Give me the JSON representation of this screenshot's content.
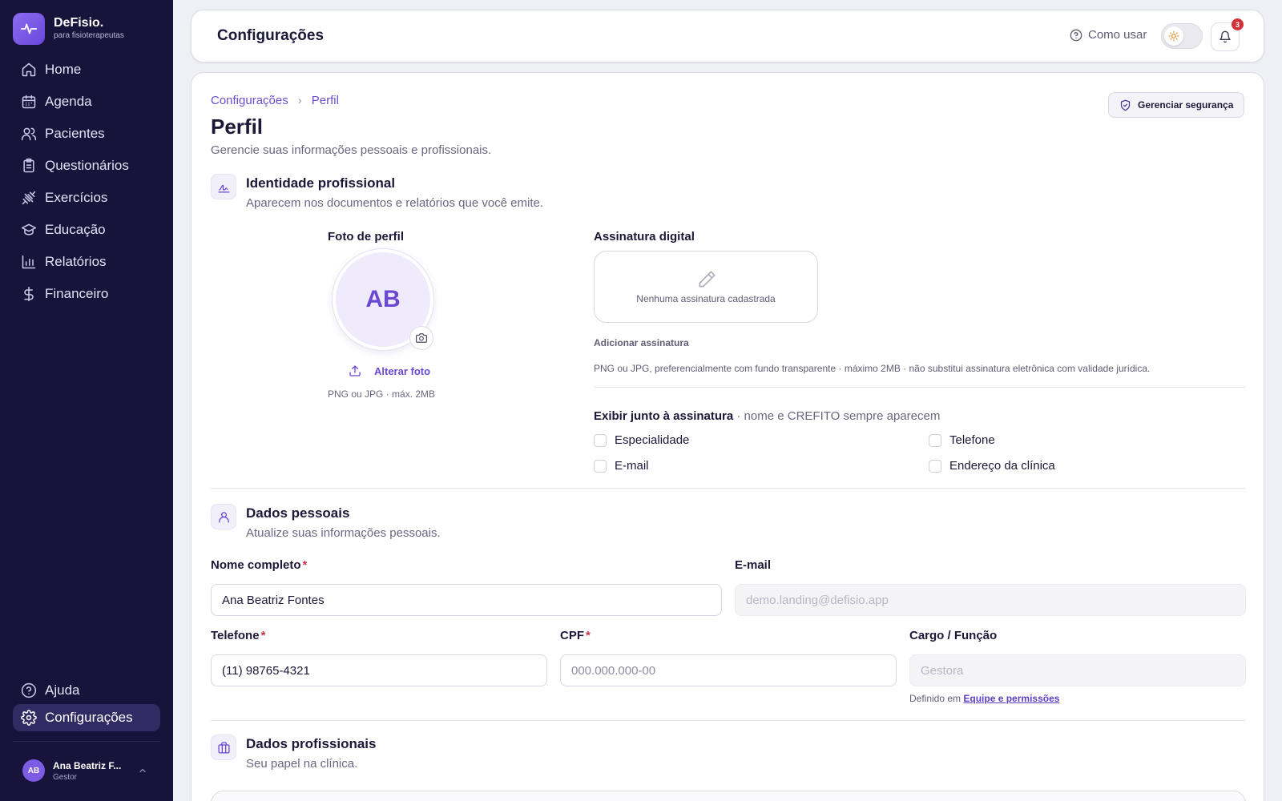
{
  "brand": {
    "name": "DeFisio.",
    "subtitle": "para fisioterapeutas"
  },
  "sidebar": {
    "items": [
      {
        "label": "Home",
        "icon": "home-icon"
      },
      {
        "label": "Agenda",
        "icon": "calendar-icon"
      },
      {
        "label": "Pacientes",
        "icon": "users-icon"
      },
      {
        "label": "Questionários",
        "icon": "clipboard-icon"
      },
      {
        "label": "Exercícios",
        "icon": "dumbbell-icon"
      },
      {
        "label": "Educação",
        "icon": "graduation-cap-icon"
      },
      {
        "label": "Relatórios",
        "icon": "bar-chart-icon"
      },
      {
        "label": "Financeiro",
        "icon": "dollar-icon"
      }
    ],
    "bottom_items": [
      {
        "label": "Ajuda",
        "icon": "help-circle-icon"
      },
      {
        "label": "Configurações",
        "icon": "gear-icon",
        "active": true
      }
    ],
    "user": {
      "initials": "AB",
      "name": "Ana Beatriz F...",
      "role": "Gestor"
    }
  },
  "header": {
    "title": "Configurações",
    "help_label": "Como usar",
    "notifications_count": "3"
  },
  "breadcrumb": {
    "root": "Configurações",
    "current": "Perfil"
  },
  "page": {
    "title": "Perfil",
    "subtitle": "Gerencie suas informações pessoais e profissionais.",
    "security_button": "Gerenciar segurança"
  },
  "identity": {
    "title": "Identidade profissional",
    "subtitle": "Aparecem nos documentos e relatórios que você emite.",
    "photo_label": "Foto de perfil",
    "avatar_initials": "AB",
    "change_photo": "Alterar foto",
    "photo_hint": "PNG ou JPG · máx. 2MB",
    "signature_label": "Assinatura digital",
    "signature_empty": "Nenhuma assinatura cadastrada",
    "add_signature": "Adicionar assinatura",
    "signature_hint": "PNG ou JPG, preferencialmente com fundo transparente · máximo 2MB · não substitui assinatura eletrônica com validade jurídica.",
    "show_label": "Exibir junto à assinatura",
    "show_note": " · nome e CREFITO sempre aparecem",
    "options": [
      {
        "label": "Especialidade",
        "checked": false
      },
      {
        "label": "Telefone",
        "checked": false
      },
      {
        "label": "E-mail",
        "checked": false
      },
      {
        "label": "Endereço da clínica",
        "checked": false
      }
    ]
  },
  "personal": {
    "title": "Dados pessoais",
    "subtitle": "Atualize suas informações pessoais.",
    "fields": {
      "name": {
        "label": "Nome completo",
        "value": "Ana Beatriz Fontes"
      },
      "email": {
        "label": "E-mail",
        "placeholder": "demo.landing@defisio.app"
      },
      "phone": {
        "label": "Telefone",
        "value": "(11) 98765-4321"
      },
      "cpf": {
        "label": "CPF",
        "placeholder": "000.000.000-00"
      },
      "role": {
        "label": "Cargo / Função",
        "placeholder": "Gestora"
      }
    },
    "role_help": "Definido em ",
    "role_help_link": "Equipe e permissões"
  },
  "professional": {
    "title": "Dados profissionais",
    "subtitle": "Seu papel na clínica."
  },
  "colors": {
    "accent": "#6a48d2",
    "sidebar_bg": "#17133a",
    "required": "#c9324b",
    "badge": "#d2323a"
  }
}
